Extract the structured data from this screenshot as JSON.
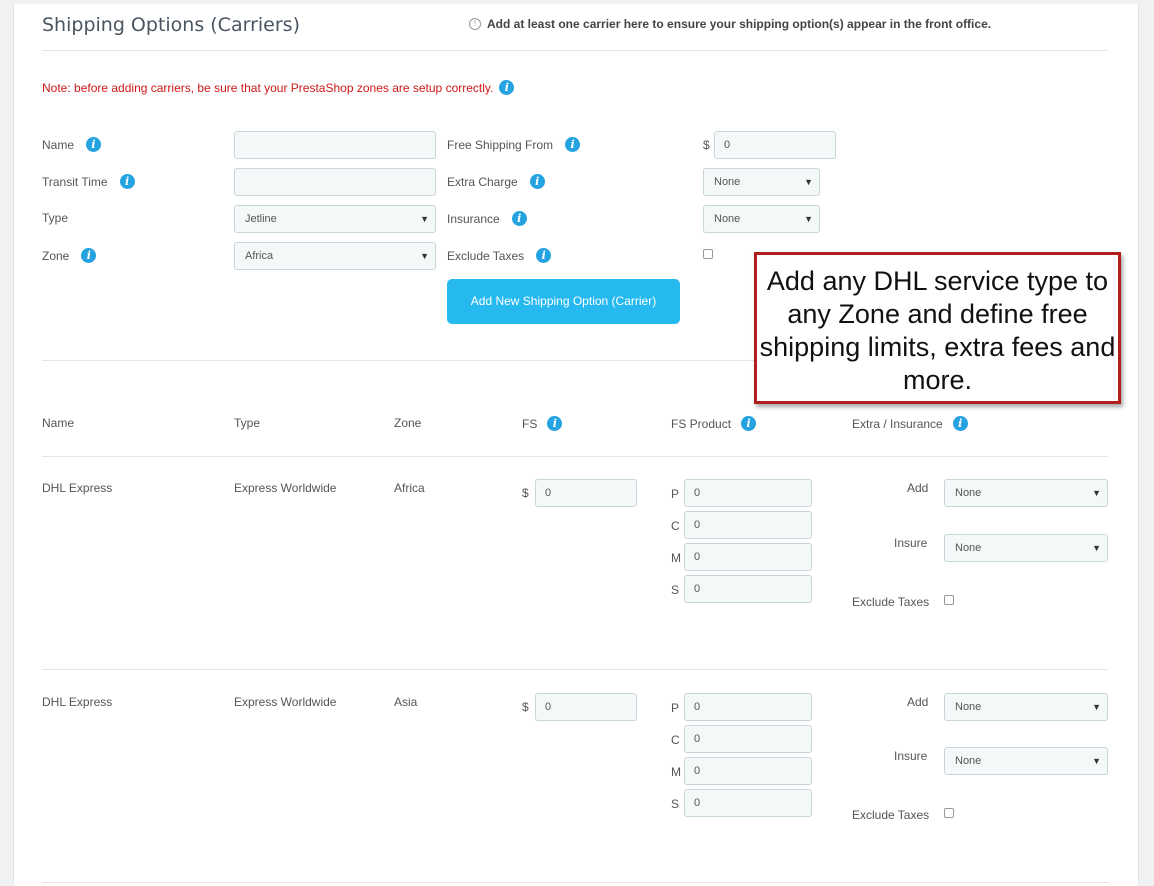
{
  "header": {
    "title": "Shipping Options (Carriers)",
    "hint": "Add at least one carrier here to ensure your shipping option(s) appear in the front office."
  },
  "note": "Note: before adding carriers, be sure that your PrestaShop zones are setup correctly.",
  "form": {
    "name_label": "Name",
    "transit_label": "Transit Time",
    "type_label": "Type",
    "zone_label": "Zone",
    "name_value": "",
    "transit_value": "",
    "type_value": "Jetline",
    "zone_value": "Africa",
    "free_from_label": "Free Shipping From",
    "extra_charge_label": "Extra Charge",
    "insurance_label": "Insurance",
    "exclude_taxes_label": "Exclude Taxes",
    "currency": "$",
    "free_from_value": "0",
    "extra_charge_value": "None",
    "insurance_value": "None",
    "submit_label": "Add New Shipping Option (Carrier)"
  },
  "callout": "Add any DHL service type to any Zone and define free shipping limits, extra fees and more.",
  "table": {
    "headers": {
      "name": "Name",
      "type": "Type",
      "zone": "Zone",
      "fs": "FS",
      "fs_product": "FS Product",
      "extra": "Extra / Insurance"
    },
    "row_labels": {
      "p": "P",
      "c": "C",
      "m": "M",
      "s": "S",
      "add": "Add",
      "insure": "Insure",
      "exclude": "Exclude Taxes",
      "currency": "$"
    },
    "rows": [
      {
        "name": "DHL Express",
        "type": "Express Worldwide",
        "zone": "Africa",
        "fs": "0",
        "p": "0",
        "c": "0",
        "m": "0",
        "s": "0",
        "add": "None",
        "insure": "None"
      },
      {
        "name": "DHL Express",
        "type": "Express Worldwide",
        "zone": "Asia",
        "fs": "0",
        "p": "0",
        "c": "0",
        "m": "0",
        "s": "0",
        "add": "None",
        "insure": "None"
      }
    ]
  }
}
